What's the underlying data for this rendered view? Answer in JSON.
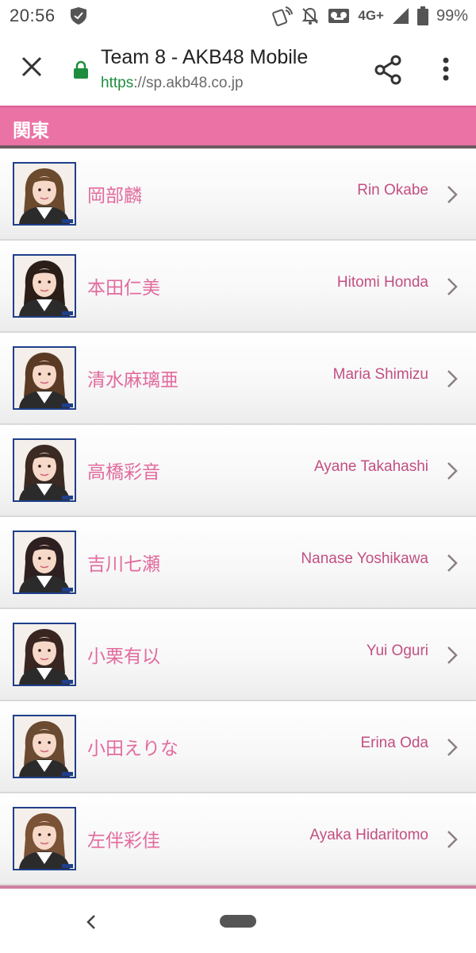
{
  "status_bar": {
    "time": "20:56",
    "network": "4G+",
    "battery": "99%"
  },
  "browser": {
    "title": "Team 8 - AKB48 Mobile",
    "url_scheme": "https",
    "url_rest": "://sp.akb48.co.jp"
  },
  "section": {
    "label": "関東"
  },
  "members": [
    {
      "name_jp": "岡部麟",
      "name_en": "Rin Okabe",
      "hair": "#6b4a2e"
    },
    {
      "name_jp": "本田仁美",
      "name_en": "Hitomi Honda",
      "hair": "#2b1e18"
    },
    {
      "name_jp": "清水麻璃亜",
      "name_en": "Maria Shimizu",
      "hair": "#5a3a24"
    },
    {
      "name_jp": "高橋彩音",
      "name_en": "Ayane Takahashi",
      "hair": "#3b2a22"
    },
    {
      "name_jp": "吉川七瀬",
      "name_en": "Nanase Yoshikawa",
      "hair": "#2e2020"
    },
    {
      "name_jp": "小栗有以",
      "name_en": "Yui Oguri",
      "hair": "#3a2620"
    },
    {
      "name_jp": "小田えりな",
      "name_en": "Erina Oda",
      "hair": "#6a4a30"
    },
    {
      "name_jp": "左伴彩佳",
      "name_en": "Ayaka Hidaritomo",
      "hair": "#7a5236"
    }
  ],
  "colors": {
    "section_header": "#ea72a5",
    "name_jp": "#e26b9e",
    "name_en": "#c24f82",
    "photo_border": "#1f3f8a"
  }
}
